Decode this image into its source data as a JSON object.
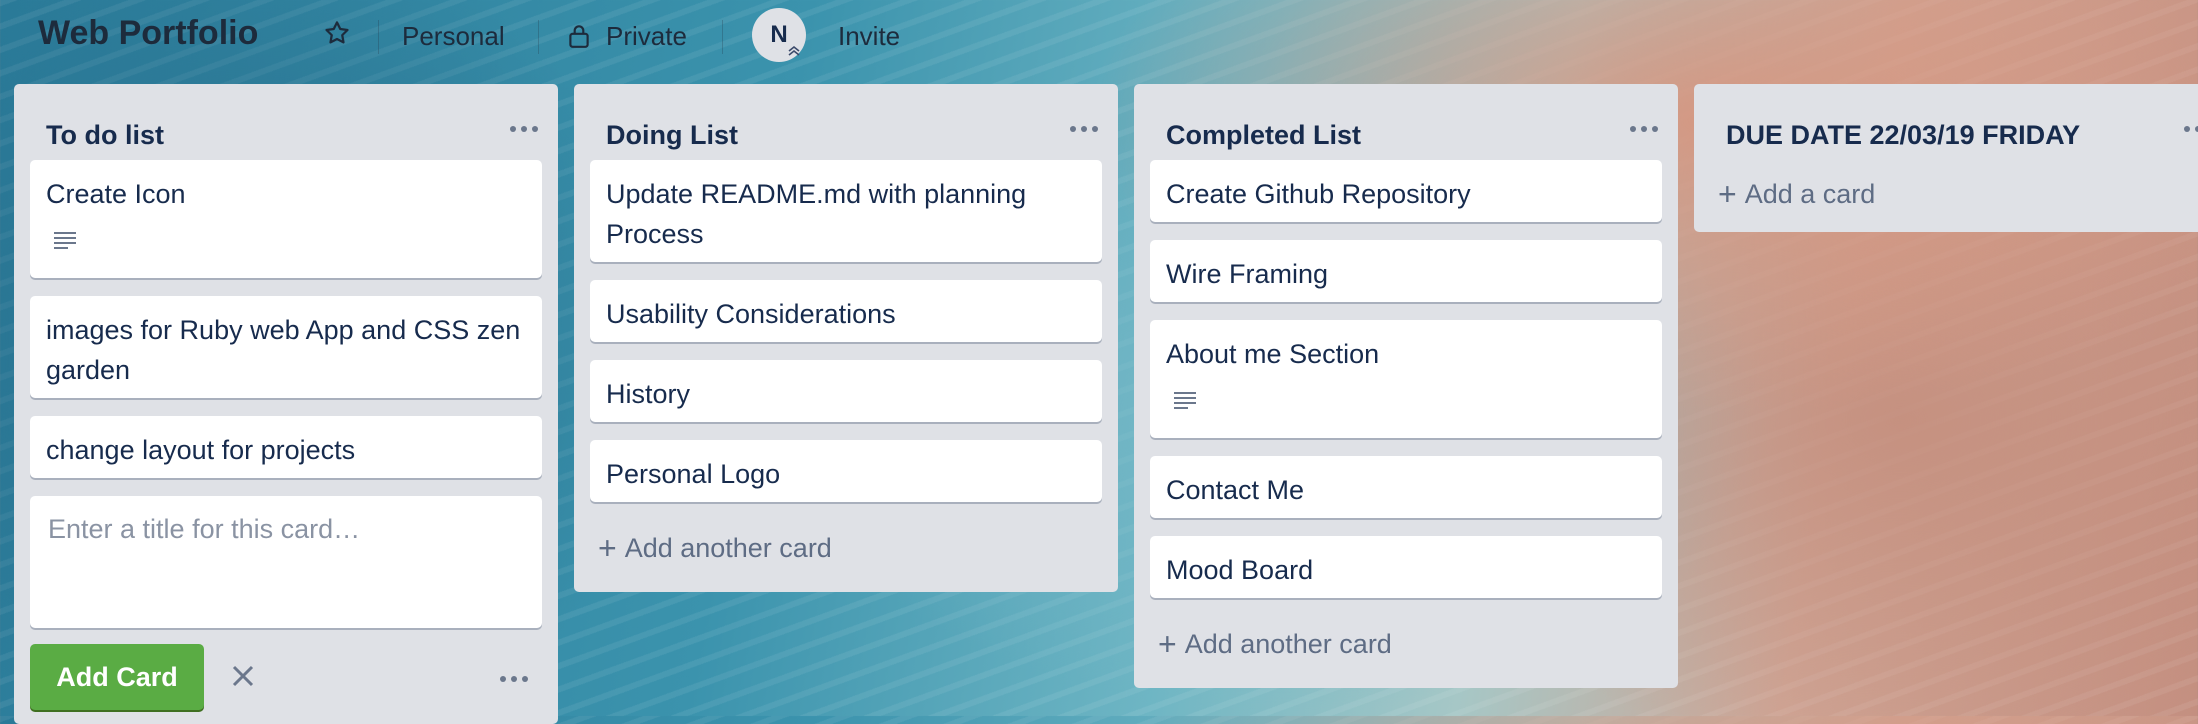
{
  "header": {
    "board_title": "Web Portfolio",
    "visibility_team": "Personal",
    "visibility_privacy": "Private",
    "member_initial": "N",
    "invite_label": "Invite"
  },
  "lists": [
    {
      "title": "To do list",
      "cards": [
        {
          "title": "Create Icon",
          "has_description": true
        },
        {
          "title": "images for Ruby web App and CSS zen garden",
          "has_description": false
        },
        {
          "title": "change layout for projects",
          "has_description": false
        }
      ],
      "composer_placeholder": "Enter a title for this card…",
      "add_card_label": "Add Card"
    },
    {
      "title": "Doing List",
      "cards": [
        {
          "title": "Update README.md with planning Process"
        },
        {
          "title": "Usability Considerations"
        },
        {
          "title": "History"
        },
        {
          "title": "Personal Logo"
        }
      ],
      "add_label": "Add another card"
    },
    {
      "title": "Completed List",
      "cards": [
        {
          "title": "Create Github Repository"
        },
        {
          "title": "Wire Framing"
        },
        {
          "title": "About me Section",
          "has_description": true
        },
        {
          "title": "Contact Me"
        },
        {
          "title": "Mood Board"
        }
      ],
      "add_label": "Add another card"
    },
    {
      "title": "DUE DATE 22/03/19 FRIDAY",
      "cards": [],
      "add_label": "Add a card"
    }
  ],
  "icons": {
    "star": "star-icon",
    "lock": "lock-icon",
    "description": "description-icon",
    "more": "more-horizontal-icon",
    "close": "close-icon"
  },
  "colors": {
    "list_bg": "#dfe1e6",
    "add_button": "#5aac44",
    "text": "#172b4d"
  }
}
